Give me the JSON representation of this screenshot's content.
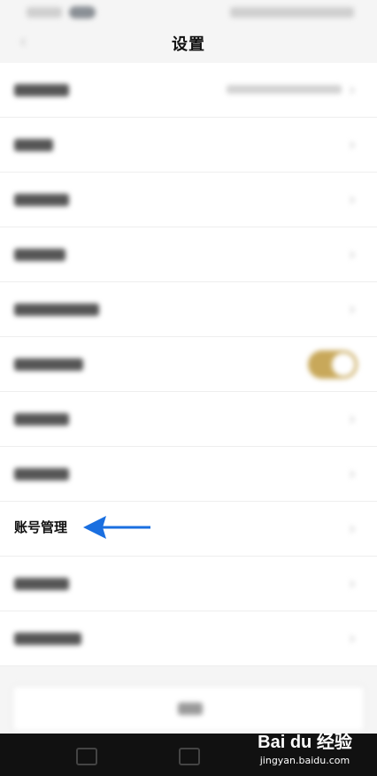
{
  "header": {
    "title": "设置"
  },
  "settings_rows": [
    {
      "label_width": 62,
      "has_value": true,
      "type": "chevron"
    },
    {
      "label_width": 44,
      "has_value": false,
      "type": "chevron"
    },
    {
      "label_width": 62,
      "has_value": false,
      "type": "chevron"
    },
    {
      "label_width": 58,
      "has_value": false,
      "type": "chevron"
    },
    {
      "label_width": 96,
      "has_value": false,
      "type": "chevron"
    },
    {
      "label_width": 78,
      "has_value": false,
      "type": "toggle",
      "toggle_on": true
    },
    {
      "label_width": 62,
      "has_value": false,
      "type": "chevron"
    },
    {
      "label_width": 62,
      "has_value": false,
      "type": "chevron"
    }
  ],
  "account_row": {
    "label": "账号管理"
  },
  "rows_after": [
    {
      "label_width": 62,
      "type": "chevron"
    },
    {
      "label_width": 76,
      "type": "chevron"
    }
  ],
  "colors": {
    "toggle_on": "#c8a85a",
    "annotation_arrow": "#1a6fe0"
  },
  "watermark": {
    "brand": "Bai du 经验",
    "url": "jingyan.baidu.com"
  }
}
